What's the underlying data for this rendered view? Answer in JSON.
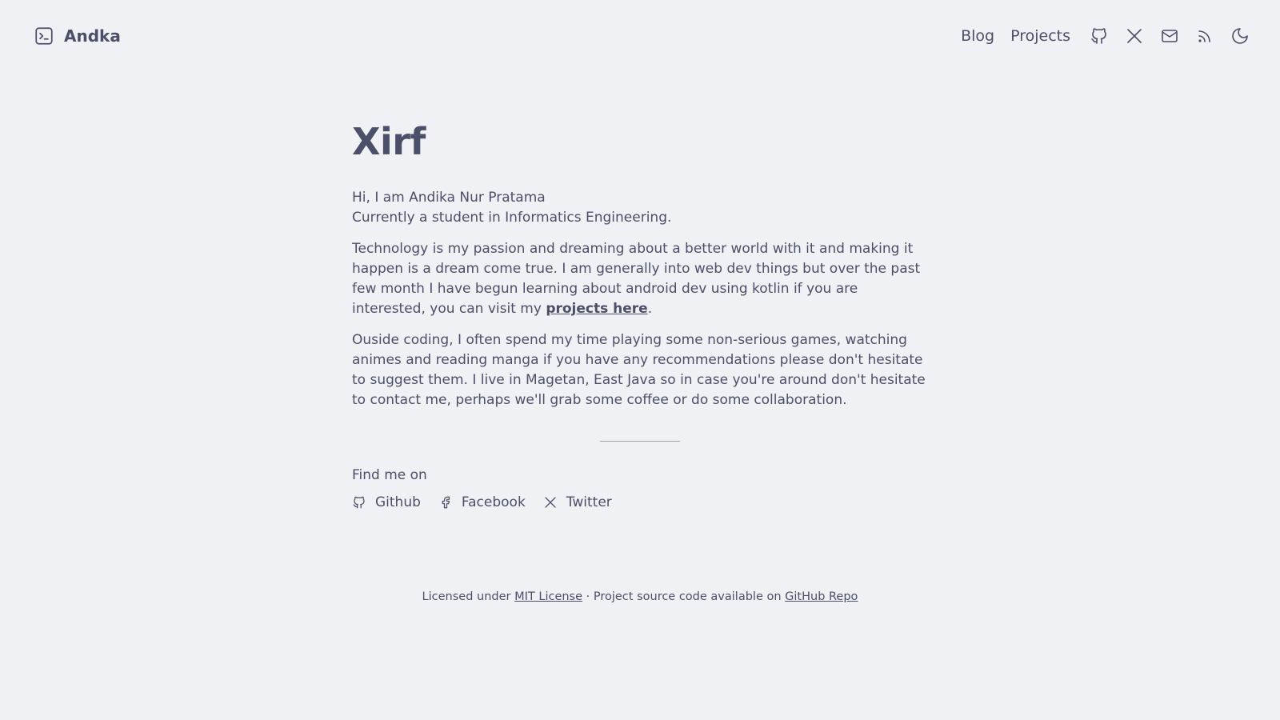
{
  "header": {
    "brand_name": "Andka",
    "brand_icon": "terminal-icon",
    "nav_links": [
      "Blog",
      "Projects"
    ],
    "nav_icons": [
      "github-icon",
      "x-twitter-icon",
      "mail-icon",
      "rss-icon",
      "moon-icon"
    ]
  },
  "main": {
    "title": "Xirf",
    "intro_line1": "Hi, I am Andika Nur Pratama",
    "intro_line2": "Currently a student in Informatics Engineering.",
    "para1_text": "Technology is my passion and dreaming about a better world with it and making it happen is a dream come true. I am generally into web dev things but over the past few month I have begun learning about android dev using kotlin if you are interested, you can visit my ",
    "para1_link": "projects here",
    "para1_end": ".",
    "para2_text": "Ouside coding, I often spend my time playing some non-serious games, watching animes and reading manga if you have any recommendations please don't hesitate to suggest them. I live in Magetan, East Java so in case you're around don't hesitate to contact me, perhaps we'll grab some coffee or do some collaboration.",
    "find_me": "Find me on",
    "socials": [
      {
        "label": "Github",
        "icon": "github-icon"
      },
      {
        "label": "Facebook",
        "icon": "facebook-icon"
      },
      {
        "label": "Twitter",
        "icon": "x-twitter-icon"
      }
    ]
  },
  "footer": {
    "prefix": "Licensed under ",
    "license_link": "MIT License",
    "middle": " · Project source code available on ",
    "repo_link": "GitHub Repo"
  },
  "colors": {
    "background": "#eff1f5",
    "text": "#4c4f69",
    "divider": "#9ca0b0"
  }
}
